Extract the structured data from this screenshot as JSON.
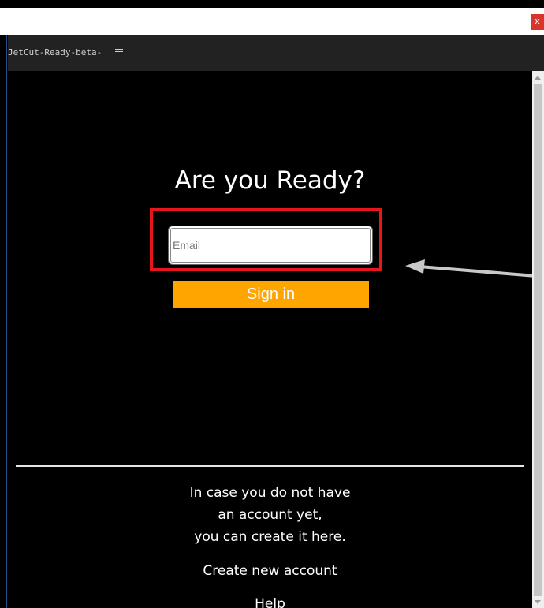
{
  "window": {
    "close_glyph": "x"
  },
  "panel": {
    "title": "JetCut-Ready-beta-",
    "menu_icon": "hamburger-menu-icon"
  },
  "login": {
    "heading": "Are you Ready?",
    "email_placeholder": "Email",
    "email_value": "",
    "signin_label": "Sign in"
  },
  "signup": {
    "info_lines": [
      "In case you do not have",
      "an account yet,",
      "you can create it here."
    ],
    "create_link": "Create new account",
    "help_link": "Help"
  },
  "colors": {
    "background": "#000000",
    "accent_button": "#FFA500",
    "highlight_box": "#E8151C",
    "arrow": "#C8C8C8"
  }
}
